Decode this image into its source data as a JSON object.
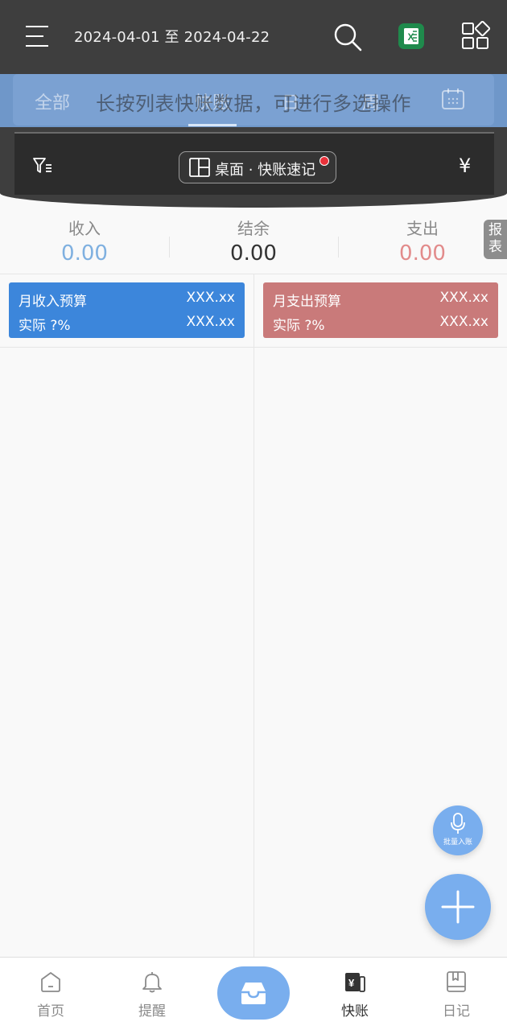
{
  "header": {
    "date_range": "2024-04-01 至 2024-04-22"
  },
  "tabs": [
    {
      "label": "全部"
    },
    {
      "label": "快账",
      "active": true
    },
    {
      "label": "日"
    },
    {
      "label": "周"
    }
  ],
  "toast": "长按列表快账数据，可进行多选操作",
  "filter_bar": {
    "desk_label": "桌面 · 快账速记",
    "currency_symbol": "¥"
  },
  "summary": {
    "income_label": "收入",
    "income_value": "0.00",
    "balance_label": "结余",
    "balance_value": "0.00",
    "expense_label": "支出",
    "expense_value": "0.00"
  },
  "report_tab": "报表",
  "budgets": {
    "income": {
      "title": "月收入预算",
      "value": "XXX.xx",
      "actual_label": "实际 ?%",
      "actual_value": "XXX.xx"
    },
    "expense": {
      "title": "月支出预算",
      "value": "XXX.xx",
      "actual_label": "实际 ?%",
      "actual_value": "XXX.xx"
    }
  },
  "voice_button_label": "批量入账",
  "bottom_nav": {
    "home": "首页",
    "remind": "提醒",
    "quick": "快账",
    "diary": "日记"
  },
  "colors": {
    "income": "#7fb0e0",
    "expense": "#e28b8b",
    "income_card": "#3c86db",
    "expense_card": "#c97a7a",
    "accent": "#79aeee"
  }
}
